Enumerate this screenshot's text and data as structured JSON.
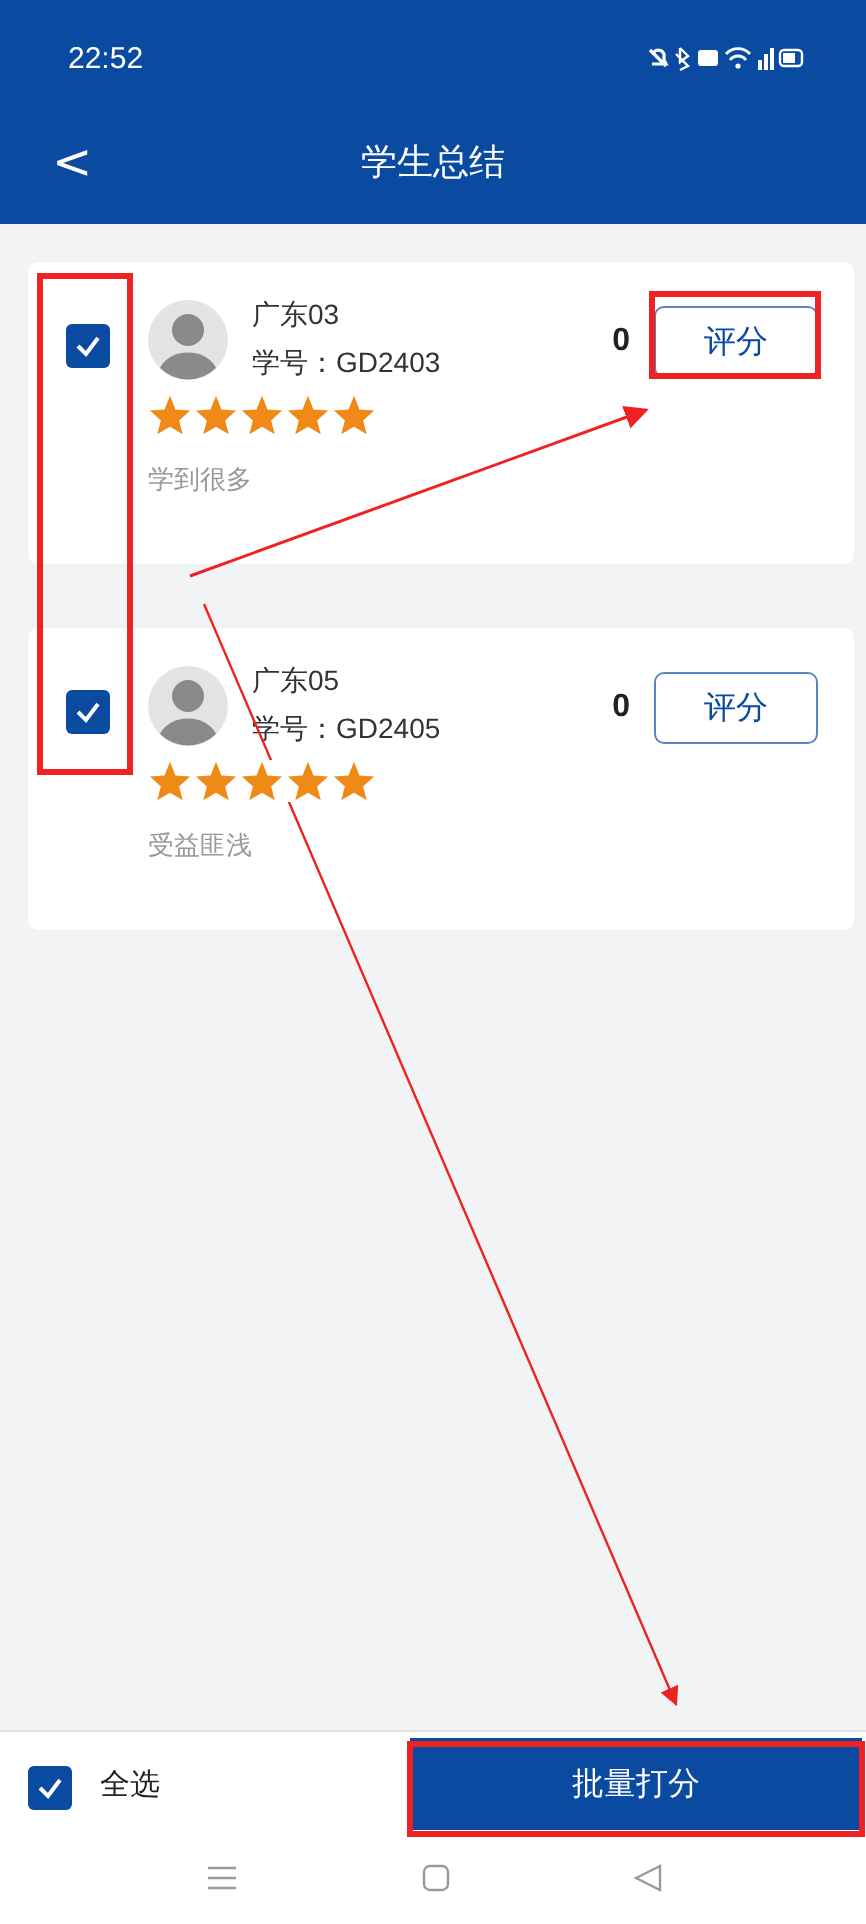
{
  "status_bar": {
    "time": "22:52"
  },
  "header": {
    "back": "<",
    "title": "学生总结"
  },
  "students": [
    {
      "checked": true,
      "name": "广东03",
      "student_id": "学号：GD2403",
      "stars": 5,
      "comment": "学到很多",
      "score": "0",
      "button": "评分"
    },
    {
      "checked": true,
      "name": "广东05",
      "student_id": "学号：GD2405",
      "stars": 5,
      "comment": "受益匪浅",
      "score": "0",
      "button": "评分"
    }
  ],
  "footer": {
    "select_all": {
      "label": "全选",
      "checked": true
    },
    "batch_button": "批量打分"
  }
}
